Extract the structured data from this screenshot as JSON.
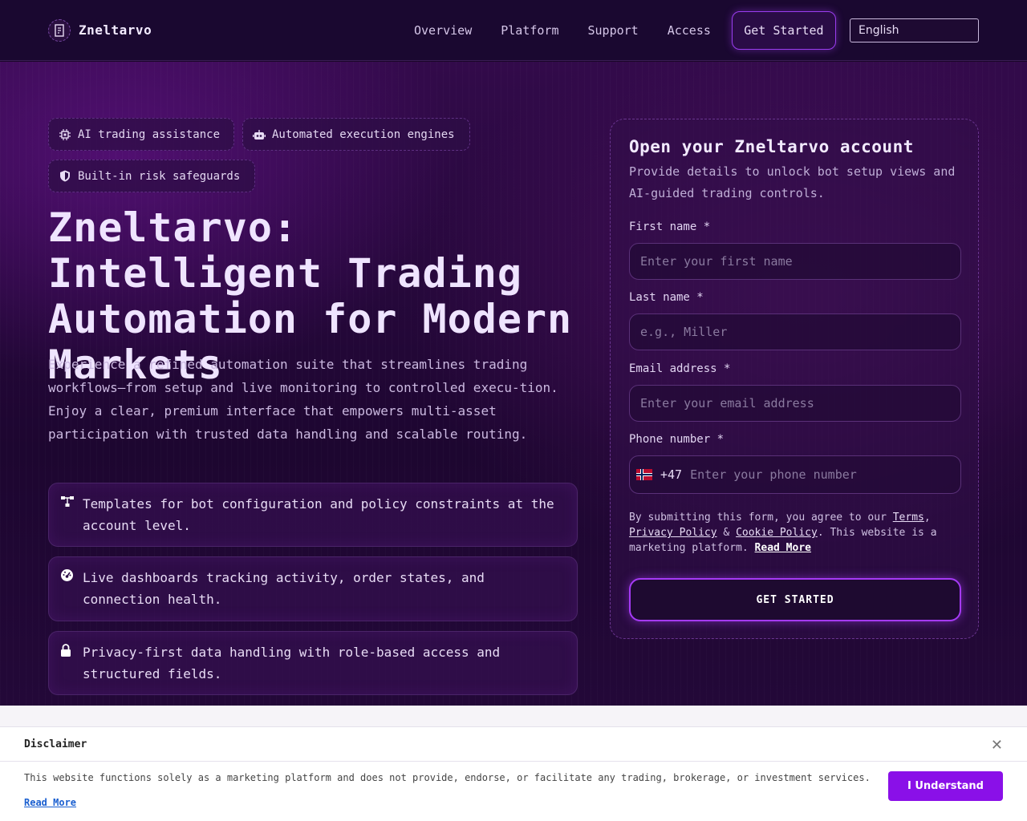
{
  "header": {
    "brand": "Zneltarvo",
    "nav": [
      "Overview",
      "Platform",
      "Support",
      "Access"
    ],
    "cta": "Get Started",
    "language": "English"
  },
  "hero": {
    "badges": [
      "AI trading assistance",
      "Automated execution engines",
      "Built-in risk safeguards"
    ],
    "title": "Zneltarvo: Intelligent Trading Automation for Modern Markets",
    "description": "Experience a refined automation suite that streamlines trading workflows—from setup and live monitoring to controlled execu-tion. Enjoy a clear, premium interface that empowers multi-asset participation with trusted data handling and scalable routing.",
    "features": [
      "Templates for bot configuration and policy constraints at the account level.",
      "Live dashboards tracking activity, order states, and connection health.",
      "Privacy-first data handling with role-based access and structured fields."
    ]
  },
  "form": {
    "title": "Open your Zneltarvo account",
    "subtitle": "Provide details to unlock bot setup views and AI-guided trading controls.",
    "first_name_label": "First name *",
    "first_name_placeholder": "Enter your first name",
    "last_name_label": "Last name *",
    "last_name_placeholder": "e.g., Miller",
    "email_label": "Email address *",
    "email_placeholder": "Enter your email address",
    "phone_label": "Phone number *",
    "phone_code": "+47",
    "phone_placeholder": "Enter your phone number",
    "consent_prefix": "By submitting this form, you agree to our ",
    "terms": "Terms",
    "privacy": "Privacy Policy",
    "amp": " & ",
    "cookie": "Cookie Policy",
    "consent_suffix": ". This website is a marketing platform. ",
    "read_more": "Read More",
    "submit": "GET STARTED"
  },
  "disclaimer": {
    "title": "Disclaimer",
    "text": "This website functions solely as a marketing platform and does not provide, endorse, or facilitate any trading, brokerage, or investment services.",
    "read_more": "Read More",
    "button": "I Understand"
  },
  "colors": {
    "accent": "#9b3df0",
    "disclaimer_button": "#8a10e8"
  }
}
